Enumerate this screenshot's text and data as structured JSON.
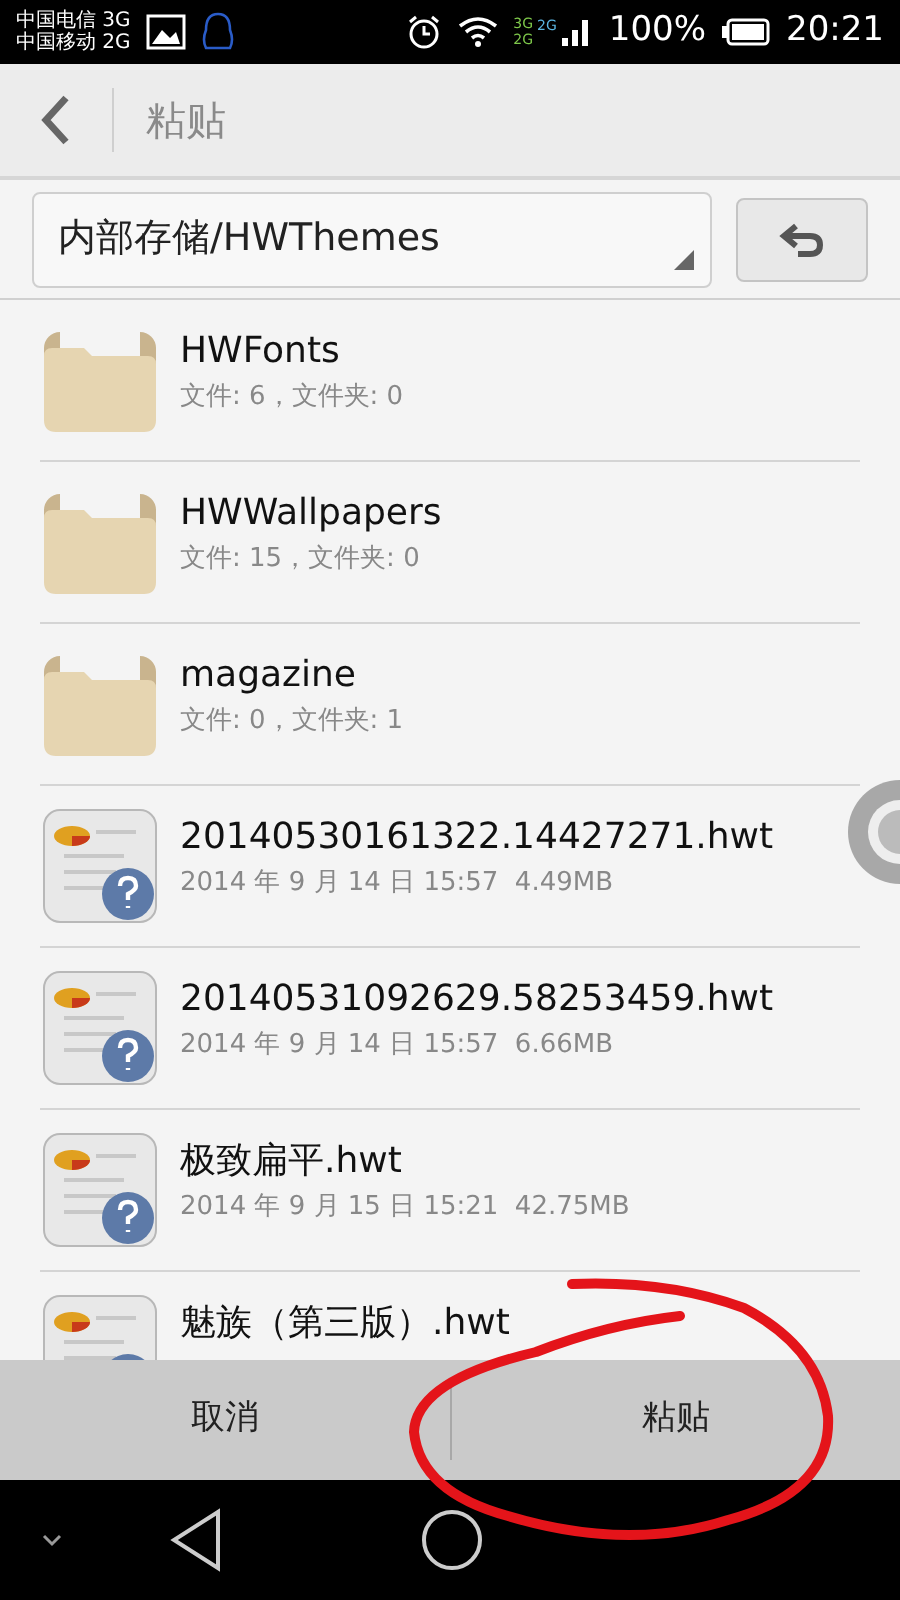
{
  "status_bar": {
    "carriers": [
      "中国电信 3G",
      "中国移动 2G"
    ],
    "network_labels": [
      "3G",
      "2G",
      "2G"
    ],
    "battery": "100%",
    "time": "20:21"
  },
  "header": {
    "title": "粘贴"
  },
  "path_bar": {
    "path": "内部存储/HWThemes"
  },
  "items": [
    {
      "kind": "folder",
      "name": "HWFonts",
      "detail": "文件: 6，文件夹: 0"
    },
    {
      "kind": "folder",
      "name": "HWWallpapers",
      "detail": "文件: 15，文件夹: 0"
    },
    {
      "kind": "folder",
      "name": "magazine",
      "detail": "文件: 0，文件夹: 1"
    },
    {
      "kind": "file",
      "name": "20140530161322.14427271.hwt",
      "detail": "2014 年 9 月 14 日 15:57  4.49MB"
    },
    {
      "kind": "file",
      "name": "20140531092629.58253459.hwt",
      "detail": "2014 年 9 月 14 日 15:57  6.66MB"
    },
    {
      "kind": "file",
      "name": "极致扁平.hwt",
      "detail": "2014 年 9 月 15 日 15:21  42.75MB"
    },
    {
      "kind": "file",
      "name": "魅族（第三版）.hwt"
    }
  ],
  "actions": [
    "取消",
    "粘贴"
  ]
}
